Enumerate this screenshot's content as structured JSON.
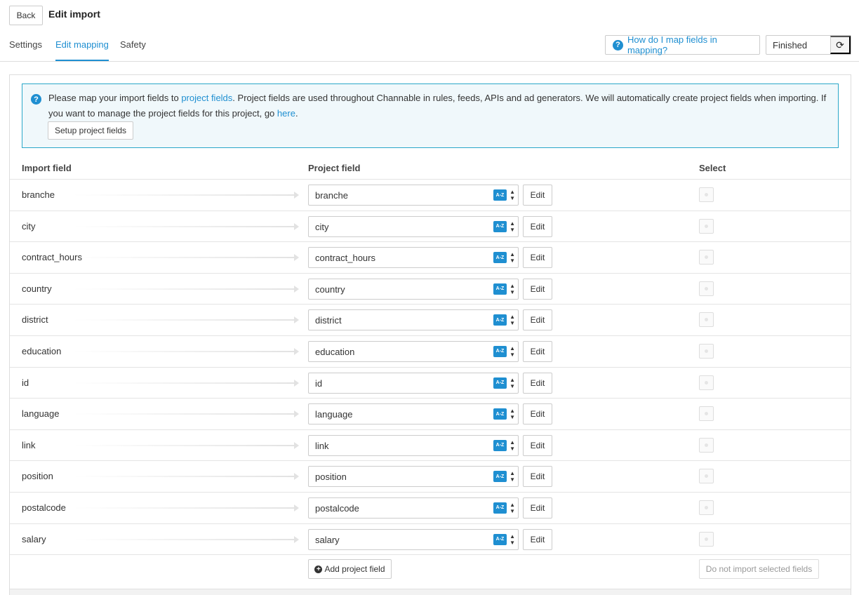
{
  "header": {
    "back_label": "Back",
    "title": "Edit import"
  },
  "tabs": [
    {
      "label": "Settings",
      "active": false
    },
    {
      "label": "Edit mapping",
      "active": true
    },
    {
      "label": "Safety",
      "active": false
    }
  ],
  "help_link": "How do I map fields in mapping?",
  "status": {
    "value": "Finished"
  },
  "info": {
    "text_before": "Please map your import fields to ",
    "link1": "project fields",
    "text_middle": ". Project fields are used throughout Channable in rules, feeds, APIs and ad generators. We will automatically create project fields when importing. If you want to manage the project fields for this project, go ",
    "link2": "here",
    "text_after": ".",
    "setup_button": "Setup project fields"
  },
  "columns": {
    "import": "Import field",
    "project": "Project field",
    "select": "Select"
  },
  "rows": [
    {
      "import": "branche",
      "project": "branche"
    },
    {
      "import": "city",
      "project": "city"
    },
    {
      "import": "contract_hours",
      "project": "contract_hours"
    },
    {
      "import": "country",
      "project": "country"
    },
    {
      "import": "district",
      "project": "district"
    },
    {
      "import": "education",
      "project": "education"
    },
    {
      "import": "id",
      "project": "id"
    },
    {
      "import": "language",
      "project": "language"
    },
    {
      "import": "link",
      "project": "link"
    },
    {
      "import": "position",
      "project": "position"
    },
    {
      "import": "postalcode",
      "project": "postalcode"
    },
    {
      "import": "salary",
      "project": "salary"
    }
  ],
  "row_labels": {
    "edit": "Edit",
    "sort_badge": "A-Z"
  },
  "footer": {
    "add_button": "Add project field",
    "no_import_button": "Do not import selected fields"
  },
  "colors": {
    "accent": "#1f8fd1",
    "info_border": "#2aa7c9"
  }
}
